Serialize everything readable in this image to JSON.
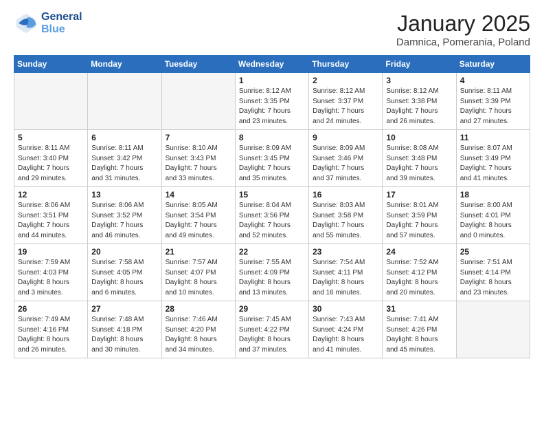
{
  "header": {
    "logo_line1": "General",
    "logo_line2": "Blue",
    "title": "January 2025",
    "location": "Damnica, Pomerania, Poland"
  },
  "weekdays": [
    "Sunday",
    "Monday",
    "Tuesday",
    "Wednesday",
    "Thursday",
    "Friday",
    "Saturday"
  ],
  "weeks": [
    [
      {
        "day": "",
        "info": "",
        "empty": true
      },
      {
        "day": "",
        "info": "",
        "empty": true
      },
      {
        "day": "",
        "info": "",
        "empty": true
      },
      {
        "day": "1",
        "info": "Sunrise: 8:12 AM\nSunset: 3:35 PM\nDaylight: 7 hours\nand 23 minutes."
      },
      {
        "day": "2",
        "info": "Sunrise: 8:12 AM\nSunset: 3:37 PM\nDaylight: 7 hours\nand 24 minutes."
      },
      {
        "day": "3",
        "info": "Sunrise: 8:12 AM\nSunset: 3:38 PM\nDaylight: 7 hours\nand 26 minutes."
      },
      {
        "day": "4",
        "info": "Sunrise: 8:11 AM\nSunset: 3:39 PM\nDaylight: 7 hours\nand 27 minutes."
      }
    ],
    [
      {
        "day": "5",
        "info": "Sunrise: 8:11 AM\nSunset: 3:40 PM\nDaylight: 7 hours\nand 29 minutes."
      },
      {
        "day": "6",
        "info": "Sunrise: 8:11 AM\nSunset: 3:42 PM\nDaylight: 7 hours\nand 31 minutes."
      },
      {
        "day": "7",
        "info": "Sunrise: 8:10 AM\nSunset: 3:43 PM\nDaylight: 7 hours\nand 33 minutes."
      },
      {
        "day": "8",
        "info": "Sunrise: 8:09 AM\nSunset: 3:45 PM\nDaylight: 7 hours\nand 35 minutes."
      },
      {
        "day": "9",
        "info": "Sunrise: 8:09 AM\nSunset: 3:46 PM\nDaylight: 7 hours\nand 37 minutes."
      },
      {
        "day": "10",
        "info": "Sunrise: 8:08 AM\nSunset: 3:48 PM\nDaylight: 7 hours\nand 39 minutes."
      },
      {
        "day": "11",
        "info": "Sunrise: 8:07 AM\nSunset: 3:49 PM\nDaylight: 7 hours\nand 41 minutes."
      }
    ],
    [
      {
        "day": "12",
        "info": "Sunrise: 8:06 AM\nSunset: 3:51 PM\nDaylight: 7 hours\nand 44 minutes."
      },
      {
        "day": "13",
        "info": "Sunrise: 8:06 AM\nSunset: 3:52 PM\nDaylight: 7 hours\nand 46 minutes."
      },
      {
        "day": "14",
        "info": "Sunrise: 8:05 AM\nSunset: 3:54 PM\nDaylight: 7 hours\nand 49 minutes."
      },
      {
        "day": "15",
        "info": "Sunrise: 8:04 AM\nSunset: 3:56 PM\nDaylight: 7 hours\nand 52 minutes."
      },
      {
        "day": "16",
        "info": "Sunrise: 8:03 AM\nSunset: 3:58 PM\nDaylight: 7 hours\nand 55 minutes."
      },
      {
        "day": "17",
        "info": "Sunrise: 8:01 AM\nSunset: 3:59 PM\nDaylight: 7 hours\nand 57 minutes."
      },
      {
        "day": "18",
        "info": "Sunrise: 8:00 AM\nSunset: 4:01 PM\nDaylight: 8 hours\nand 0 minutes."
      }
    ],
    [
      {
        "day": "19",
        "info": "Sunrise: 7:59 AM\nSunset: 4:03 PM\nDaylight: 8 hours\nand 3 minutes."
      },
      {
        "day": "20",
        "info": "Sunrise: 7:58 AM\nSunset: 4:05 PM\nDaylight: 8 hours\nand 6 minutes."
      },
      {
        "day": "21",
        "info": "Sunrise: 7:57 AM\nSunset: 4:07 PM\nDaylight: 8 hours\nand 10 minutes."
      },
      {
        "day": "22",
        "info": "Sunrise: 7:55 AM\nSunset: 4:09 PM\nDaylight: 8 hours\nand 13 minutes."
      },
      {
        "day": "23",
        "info": "Sunrise: 7:54 AM\nSunset: 4:11 PM\nDaylight: 8 hours\nand 16 minutes."
      },
      {
        "day": "24",
        "info": "Sunrise: 7:52 AM\nSunset: 4:12 PM\nDaylight: 8 hours\nand 20 minutes."
      },
      {
        "day": "25",
        "info": "Sunrise: 7:51 AM\nSunset: 4:14 PM\nDaylight: 8 hours\nand 23 minutes."
      }
    ],
    [
      {
        "day": "26",
        "info": "Sunrise: 7:49 AM\nSunset: 4:16 PM\nDaylight: 8 hours\nand 26 minutes."
      },
      {
        "day": "27",
        "info": "Sunrise: 7:48 AM\nSunset: 4:18 PM\nDaylight: 8 hours\nand 30 minutes."
      },
      {
        "day": "28",
        "info": "Sunrise: 7:46 AM\nSunset: 4:20 PM\nDaylight: 8 hours\nand 34 minutes."
      },
      {
        "day": "29",
        "info": "Sunrise: 7:45 AM\nSunset: 4:22 PM\nDaylight: 8 hours\nand 37 minutes."
      },
      {
        "day": "30",
        "info": "Sunrise: 7:43 AM\nSunset: 4:24 PM\nDaylight: 8 hours\nand 41 minutes."
      },
      {
        "day": "31",
        "info": "Sunrise: 7:41 AM\nSunset: 4:26 PM\nDaylight: 8 hours\nand 45 minutes."
      },
      {
        "day": "",
        "info": "",
        "empty": true
      }
    ]
  ]
}
